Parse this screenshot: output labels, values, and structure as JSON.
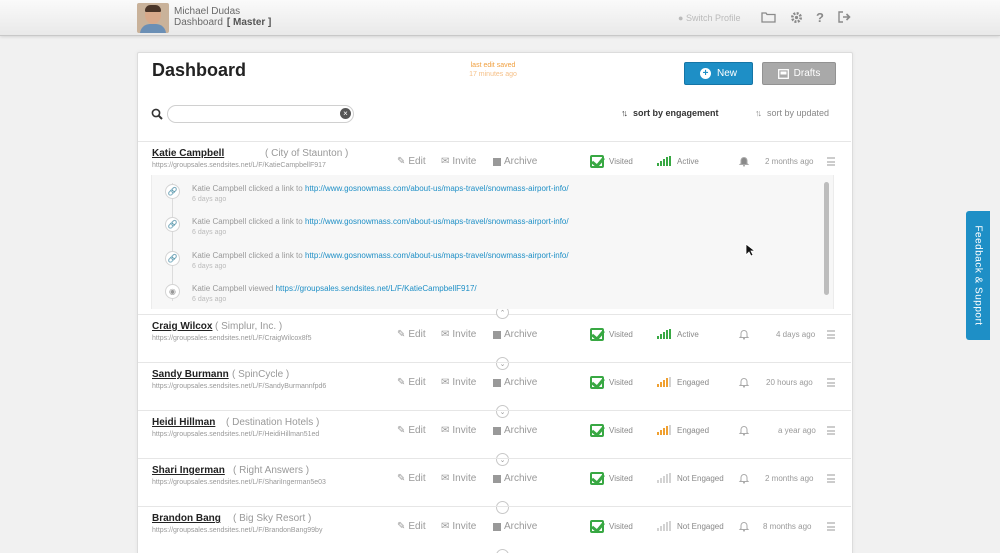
{
  "topbar": {
    "user_name": "Michael Dudas",
    "subtitle": "Dashboard",
    "role": "[ Master ]",
    "switch_profile": "Switch Profile"
  },
  "page": {
    "title": "Dashboard",
    "saved_label": "last edit saved",
    "saved_ago": "17 minutes ago",
    "new_label": "New",
    "drafts_label": "Drafts",
    "search_placeholder": "",
    "sort_engagement": "sort by engagement",
    "sort_updated": "sort by updated"
  },
  "actions": {
    "edit": "Edit",
    "invite": "Invite",
    "archive": "Archive",
    "visited": "Visited"
  },
  "contacts": [
    {
      "name": "Katie Campbell",
      "org": "( City of Staunton )",
      "url": "https://groupsales.sendsites.net/L/F/KatieCampbellF917",
      "status": "Active",
      "level": 4,
      "time": "2 months ago"
    },
    {
      "name": "Craig Wilcox",
      "org": "( Simplur, Inc. )",
      "url": "https://groupsales.sendsites.net/L/F/CraigWilcox8f5",
      "status": "Active",
      "level": 4,
      "time": "4 days ago"
    },
    {
      "name": "Sandy Burmann",
      "org": "( SpinCycle )",
      "url": "https://groupsales.sendsites.net/L/F/SandyBurmannfpd6",
      "status": "Engaged",
      "level": 3,
      "time": "20 hours ago"
    },
    {
      "name": "Heidi Hillman",
      "org": "( Destination Hotels )",
      "url": "https://groupsales.sendsites.net/L/F/HeidiHillman51ed",
      "status": "Engaged",
      "level": 3,
      "time": "a year ago"
    },
    {
      "name": "Shari Ingerman",
      "org": "( Right Answers )",
      "url": "https://groupsales.sendsites.net/L/F/ShariIngerman5e03",
      "status": "Not Engaged",
      "level": 0,
      "time": "2 months ago"
    },
    {
      "name": "Brandon Bang",
      "org": "( Big Sky Resort )",
      "url": "https://groupsales.sendsites.net/L/F/BrandonBang99by",
      "status": "Not Engaged",
      "level": 0,
      "time": "8 months ago"
    }
  ],
  "activity": [
    {
      "text": "Katie Campbell clicked a link to",
      "link": "http://www.gosnowmass.com/about-us/maps-travel/snowmass-airport-info/",
      "ago": "6 days ago",
      "icon": "link-icon"
    },
    {
      "text": "Katie Campbell clicked a link to",
      "link": "http://www.gosnowmass.com/about-us/maps-travel/snowmass-airport-info/",
      "ago": "6 days ago",
      "icon": "link-icon"
    },
    {
      "text": "Katie Campbell clicked a link to",
      "link": "http://www.gosnowmass.com/about-us/maps-travel/snowmass-airport-info/",
      "ago": "6 days ago",
      "icon": "link-icon"
    },
    {
      "text": "Katie Campbell viewed",
      "link": "https://groupsales.sendsites.net/L/F/KatieCampbellF917/",
      "ago": "6 days ago",
      "icon": "eye-icon"
    }
  ],
  "feedback_label": "Feedback & Support",
  "colors": {
    "accent": "#1e8fc6",
    "active": "#38a843",
    "engaged": "#f0a030",
    "muted": "#d3d3d3"
  }
}
